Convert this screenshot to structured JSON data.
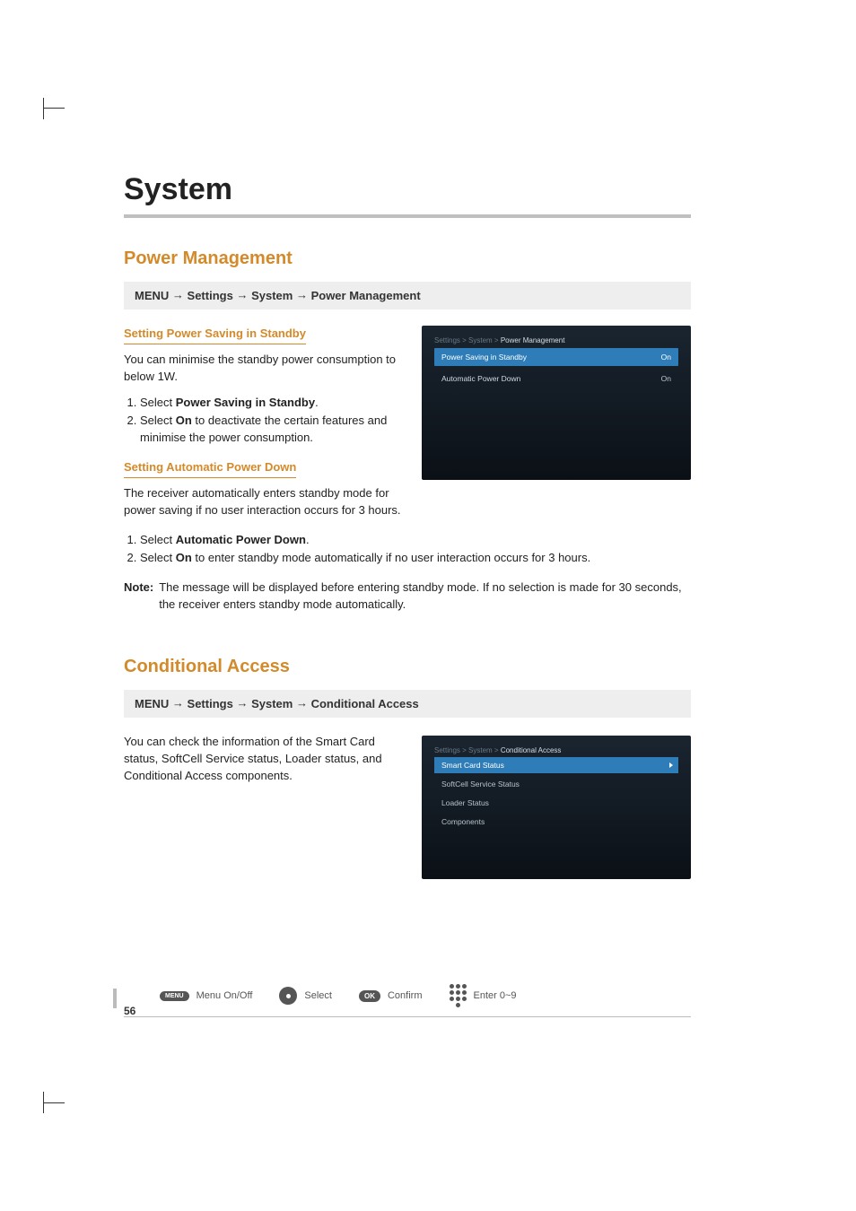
{
  "page_number": "56",
  "chapter_title": "System",
  "sections": {
    "power_management": {
      "title": "Power Management",
      "nav_prefix": "MENU",
      "nav_sep": "→",
      "nav_1": "Settings",
      "nav_2": "System",
      "nav_3": "Power Management",
      "sub1_heading": "Setting Power Saving in Standby",
      "sub1_para": "You can minimise the standby power consumption to below 1W.",
      "sub1_step1_pre": "Select ",
      "sub1_step1_bold": "Power Saving in Standby",
      "sub1_step1_post": ".",
      "sub1_step2_pre": "Select ",
      "sub1_step2_bold": "On",
      "sub1_step2_post": " to deactivate the certain features and minimise the power consumption.",
      "sub2_heading": "Setting Automatic Power Down",
      "sub2_para": "The receiver automatically enters standby mode for power saving if no user interaction occurs for 3 hours.",
      "sub2_step1_pre": "Select ",
      "sub2_step1_bold": "Automatic Power Down",
      "sub2_step1_post": ".",
      "sub2_step2_pre": "Select ",
      "sub2_step2_bold": "On",
      "sub2_step2_post": " to enter standby mode automatically if no user interaction occurs for 3 hours.",
      "note_label": "Note:",
      "note_text": "The message will be displayed before entering standby mode. If no selection is made for 30 seconds, the receiver enters standby mode automatically.",
      "screen": {
        "bc_1": "Settings",
        "bc_2": "System",
        "bc_3": "Power Management",
        "row1_label": "Power Saving in Standby",
        "row1_value": "On",
        "row2_label": "Automatic Power Down",
        "row2_value": "On"
      }
    },
    "conditional_access": {
      "title": "Conditional Access",
      "nav_prefix": "MENU",
      "nav_sep": "→",
      "nav_1": "Settings",
      "nav_2": "System",
      "nav_3": "Conditional Access",
      "para": "You can check the information of the Smart Card status, SoftCell Service status, Loader status, and Conditional Access components.",
      "screen": {
        "bc_1": "Settings",
        "bc_2": "System",
        "bc_3": "Conditional Access",
        "item1": "Smart Card Status",
        "item2": "SoftCell Service Status",
        "item3": "Loader Status",
        "item4": "Components"
      }
    }
  },
  "footer": {
    "menu_btn": "MENU",
    "menu_label": "Menu On/Off",
    "select_label": "Select",
    "ok_btn": "OK",
    "confirm_label": "Confirm",
    "enter_label": "Enter 0~9"
  }
}
